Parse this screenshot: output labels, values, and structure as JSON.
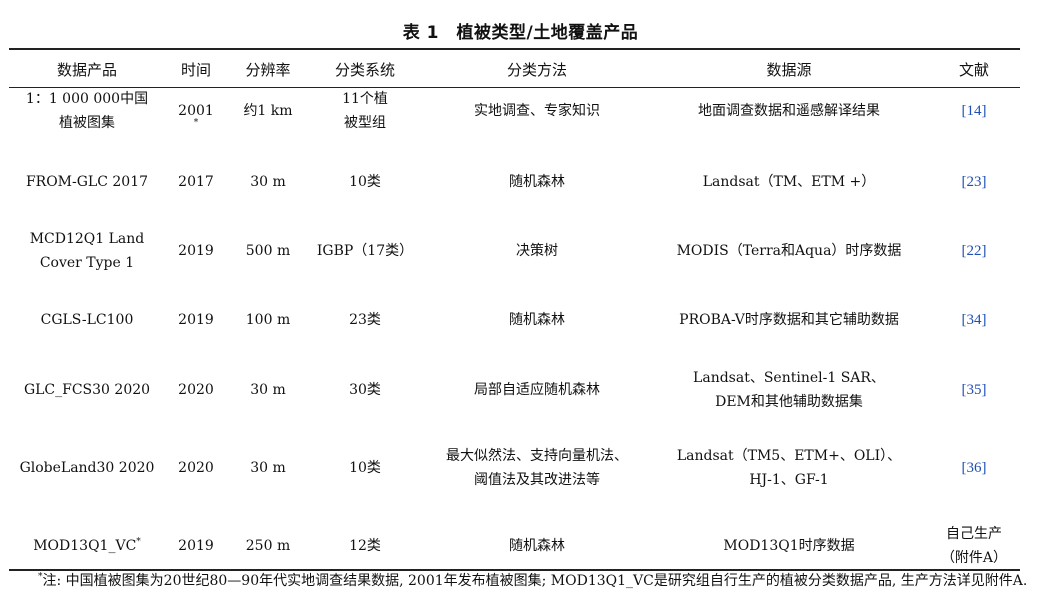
{
  "title": "表 1　植被类型/土地覆盖产品",
  "headers": [
    "数据产品",
    "时间",
    "分辨率",
    "分类系统",
    "分类方法",
    "数据源",
    "文献"
  ],
  "rows": [
    {
      "product": [
        "1：1 000 000中国",
        "植被图集"
      ],
      "product_sup": "",
      "year": "2001",
      "year_sup": "*",
      "resolution": "约1 km",
      "system": [
        "11个植",
        "被型组"
      ],
      "method": [
        "实地调查、专家知识"
      ],
      "source": [
        "地面调查数据和遥感解译结果"
      ],
      "ref": [
        "[14]"
      ]
    },
    {
      "product": [
        "FROM-GLC 2017"
      ],
      "product_sup": "",
      "year": "2017",
      "year_sup": "",
      "resolution": "30 m",
      "system": [
        "10类"
      ],
      "method": [
        "随机森林"
      ],
      "source": [
        "Landsat（TM、ETM +）"
      ],
      "ref": [
        "[23]"
      ]
    },
    {
      "product": [
        "MCD12Q1 Land",
        "Cover Type 1"
      ],
      "product_sup": "",
      "year": "2019",
      "year_sup": "",
      "resolution": "500 m",
      "system": [
        "IGBP（17类）"
      ],
      "method": [
        "决策树"
      ],
      "source": [
        "MODIS（Terra和Aqua）时序数据"
      ],
      "ref": [
        "[22]"
      ]
    },
    {
      "product": [
        "CGLS-LC100"
      ],
      "product_sup": "",
      "year": "2019",
      "year_sup": "",
      "resolution": "100 m",
      "system": [
        "23类"
      ],
      "method": [
        "随机森林"
      ],
      "source": [
        "PROBA-V时序数据和其它辅助数据"
      ],
      "ref": [
        "[34]"
      ]
    },
    {
      "product": [
        "GLC_FCS30 2020"
      ],
      "product_sup": "",
      "year": "2020",
      "year_sup": "",
      "resolution": "30 m",
      "system": [
        "30类"
      ],
      "method": [
        "局部自适应随机森林"
      ],
      "source": [
        "Landsat、Sentinel-1 SAR、",
        "DEM和其他辅助数据集"
      ],
      "ref": [
        "[35]"
      ]
    },
    {
      "product": [
        "GlobeLand30 2020"
      ],
      "product_sup": "",
      "year": "2020",
      "year_sup": "",
      "resolution": "30 m",
      "system": [
        "10类"
      ],
      "method": [
        "最大似然法、支持向量机法、",
        "阈值法及其改进法等"
      ],
      "source": [
        "Landsat（TM5、ETM+、OLI）、",
        "HJ-1、GF-1"
      ],
      "ref": [
        "[36]"
      ]
    },
    {
      "product": [
        "MOD13Q1_VC"
      ],
      "product_sup": "*",
      "year": "2019",
      "year_sup": "",
      "resolution": "250 m",
      "system": [
        "12类"
      ],
      "method": [
        "随机森林"
      ],
      "source": [
        "MOD13Q1时序数据"
      ],
      "ref": [
        "自己生产",
        "（附件A）"
      ]
    }
  ],
  "note": {
    "mark": "*",
    "text": "注: 中国植被图集为20世纪80—90年代实地调查结果数据, 2001年发布植被图集; MOD13Q1_VC是研究组自行生产的植被分类数据产品, 生产方法详见附件A."
  },
  "colors": {
    "ref_link": "#1f4fb4",
    "text": "#111111",
    "rule": "#222222"
  }
}
